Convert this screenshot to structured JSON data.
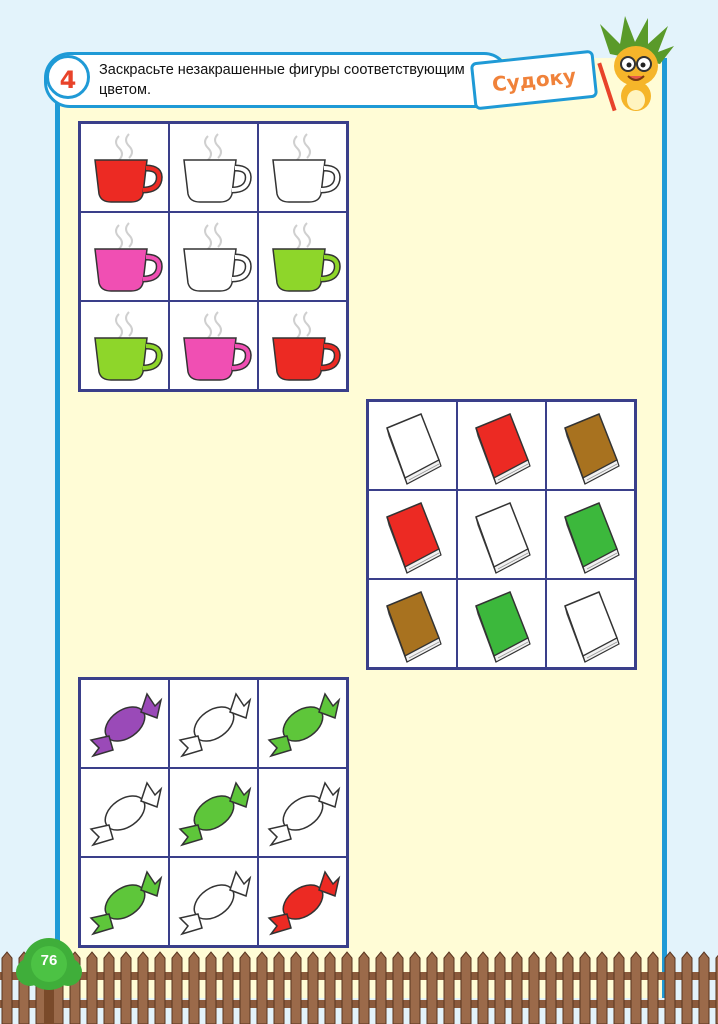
{
  "header": {
    "task_number": "4",
    "instruction": "Заскрасьте незакрашенные фигуры соответствующим цветом.",
    "badge": "Судоку"
  },
  "page_number": "76",
  "colors": {
    "red": "#ec2a23",
    "pink": "#f04fb3",
    "green": "#8ed62a",
    "brown": "#a8721f",
    "book_green": "#3cb83c",
    "purple": "#9a4ab8",
    "candy_green": "#5ec63a",
    "white": "#ffffff"
  },
  "grids": [
    {
      "name": "cups-grid",
      "item": "cup",
      "cells": [
        "red",
        "white",
        "white",
        "pink",
        "white",
        "green",
        "green",
        "pink",
        "red"
      ]
    },
    {
      "name": "books-grid",
      "item": "book",
      "cells": [
        "white",
        "red",
        "brown",
        "red",
        "white",
        "book_green",
        "brown",
        "book_green",
        "white"
      ]
    },
    {
      "name": "candies-grid",
      "item": "candy",
      "cells": [
        "purple",
        "white",
        "candy_green",
        "white",
        "candy_green",
        "white",
        "candy_green",
        "white",
        "red"
      ]
    }
  ]
}
